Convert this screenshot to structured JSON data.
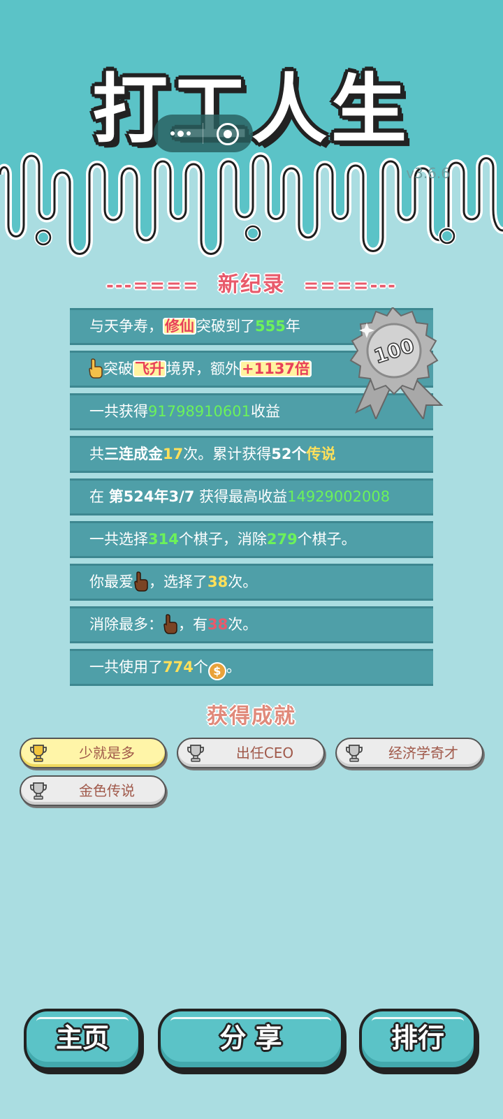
{
  "game": {
    "title": "打工人生",
    "version": "v3.6.6"
  },
  "record": {
    "title": "新纪录",
    "dashes_left": "---====",
    "dashes_right": "====---",
    "badge_number": "100"
  },
  "stats": {
    "r1": {
      "a": "与天争寿，",
      "hl": "修仙",
      "b": "突破到了",
      "num": "555",
      "c": "年"
    },
    "r2": {
      "a": "突破",
      "hl": "飞升",
      "b": "境界，额外",
      "hl2": "+1137倍"
    },
    "r3": {
      "a": "一共获得",
      "num": "91798910601",
      "b": "收益"
    },
    "r4": {
      "a": "共",
      "bold": "三连成金",
      "num": "17",
      "b": "次。累计获得",
      "num2": "52个",
      "c": "传说"
    },
    "r5": {
      "a": "在 ",
      "bold": "第524年3/7",
      "b": " 获得最高收益",
      "num": "14929002008"
    },
    "r6": {
      "a": "一共选择",
      "num": "314",
      "b": "个棋子，消除",
      "num2": "279",
      "c": "个棋子。"
    },
    "r7": {
      "a": "你最爱",
      "b": "，选择了",
      "num": "38",
      "c": "次。"
    },
    "r8": {
      "a": "消除最多：",
      "b": "，有",
      "num": "38",
      "c": "次。"
    },
    "r9": {
      "a": "一共使用了",
      "num": "774",
      "b": "个",
      "coin": "$",
      "c": "。"
    }
  },
  "achievements": {
    "title": "获得成就",
    "items": [
      "少就是多",
      "出任CEO",
      "经济学奇才",
      "金色传说"
    ],
    "unlocked": [
      true,
      false,
      false,
      false
    ]
  },
  "buttons": {
    "home": "主页",
    "share": "分 享",
    "rank": "排行"
  },
  "colors": {
    "bg": "#aadde1",
    "header": "#5bc3c7",
    "row": "#4f9fa8",
    "green": "#6cf25a",
    "yellow": "#ffe05a",
    "red": "#e85a6b"
  }
}
